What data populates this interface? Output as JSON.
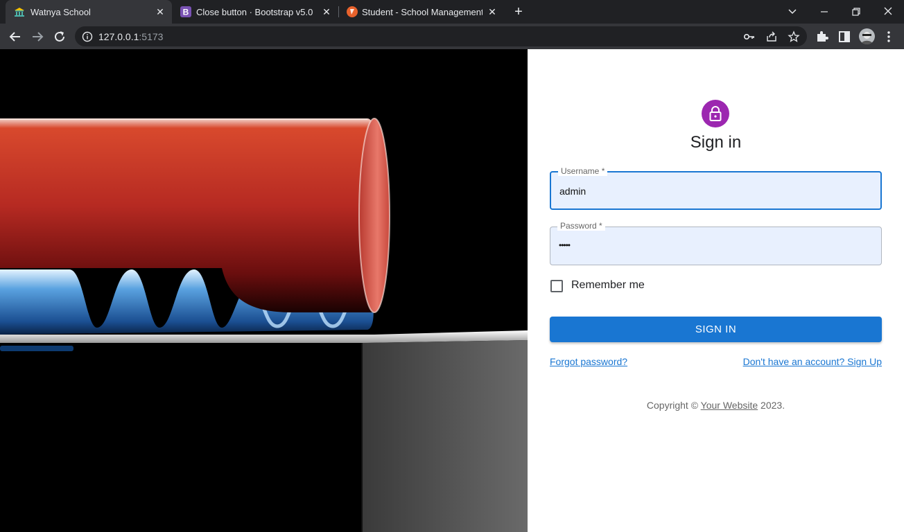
{
  "browser": {
    "tabs": [
      {
        "title": "Watnya School",
        "active": true
      },
      {
        "title": "Close button · Bootstrap v5.0",
        "active": false
      },
      {
        "title": "Student - School Management Sy",
        "active": false
      }
    ],
    "url_host": "127.0.0.1",
    "url_port": ":5173"
  },
  "login": {
    "title": "Sign in",
    "username_label": "Username *",
    "username_value": "admin",
    "password_label": "Password *",
    "password_value": "•••••",
    "remember_label": "Remember me",
    "remember_checked": false,
    "submit_label": "SIGN IN",
    "forgot_link": "Forgot password?",
    "signup_link": "Don't have an account? Sign Up",
    "copyright_prefix": "Copyright © ",
    "copyright_site": "Your Website",
    "copyright_year": " 2023."
  },
  "colors": {
    "accent": "#1976d2",
    "avatar": "#9c27b0",
    "field_bg": "#e8f0fe"
  }
}
